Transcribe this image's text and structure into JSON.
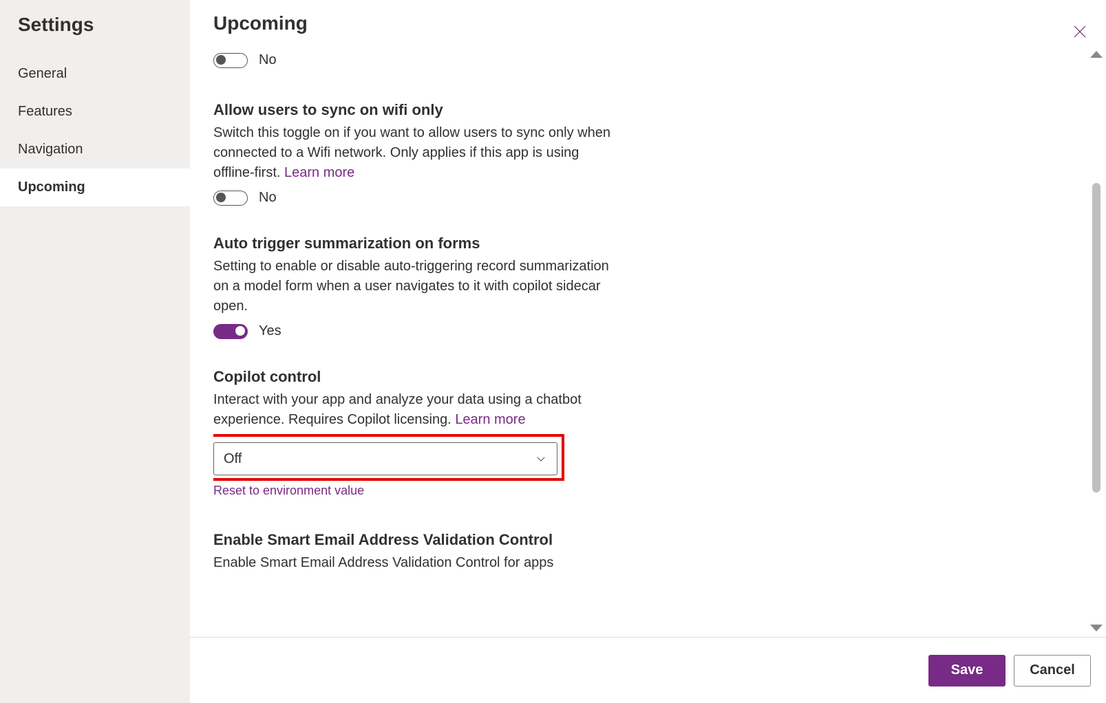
{
  "sidebar": {
    "title": "Settings",
    "items": [
      {
        "label": "General",
        "active": false
      },
      {
        "label": "Features",
        "active": false
      },
      {
        "label": "Navigation",
        "active": false
      },
      {
        "label": "Upcoming",
        "active": true
      }
    ]
  },
  "page": {
    "title": "Upcoming"
  },
  "settings": {
    "orphan_toggle": {
      "value": "No"
    },
    "wifi": {
      "title": "Allow users to sync on wifi only",
      "desc": "Switch this toggle on if you want to allow users to sync only when connected to a Wifi network. Only applies if this app is using offline-first. ",
      "learn_more": "Learn more",
      "value": "No"
    },
    "auto_summary": {
      "title": "Auto trigger summarization on forms",
      "desc": "Setting to enable or disable auto-triggering record summarization on a model form when a user navigates to it with copilot sidecar open.",
      "value": "Yes"
    },
    "copilot": {
      "title": "Copilot control",
      "desc": "Interact with your app and analyze your data using a chatbot experience. Requires Copilot licensing. ",
      "learn_more": "Learn more",
      "selected": "Off",
      "reset": "Reset to environment value"
    },
    "smart_email": {
      "title": "Enable Smart Email Address Validation Control",
      "desc": "Enable Smart Email Address Validation Control for apps"
    }
  },
  "footer": {
    "save": "Save",
    "cancel": "Cancel"
  }
}
